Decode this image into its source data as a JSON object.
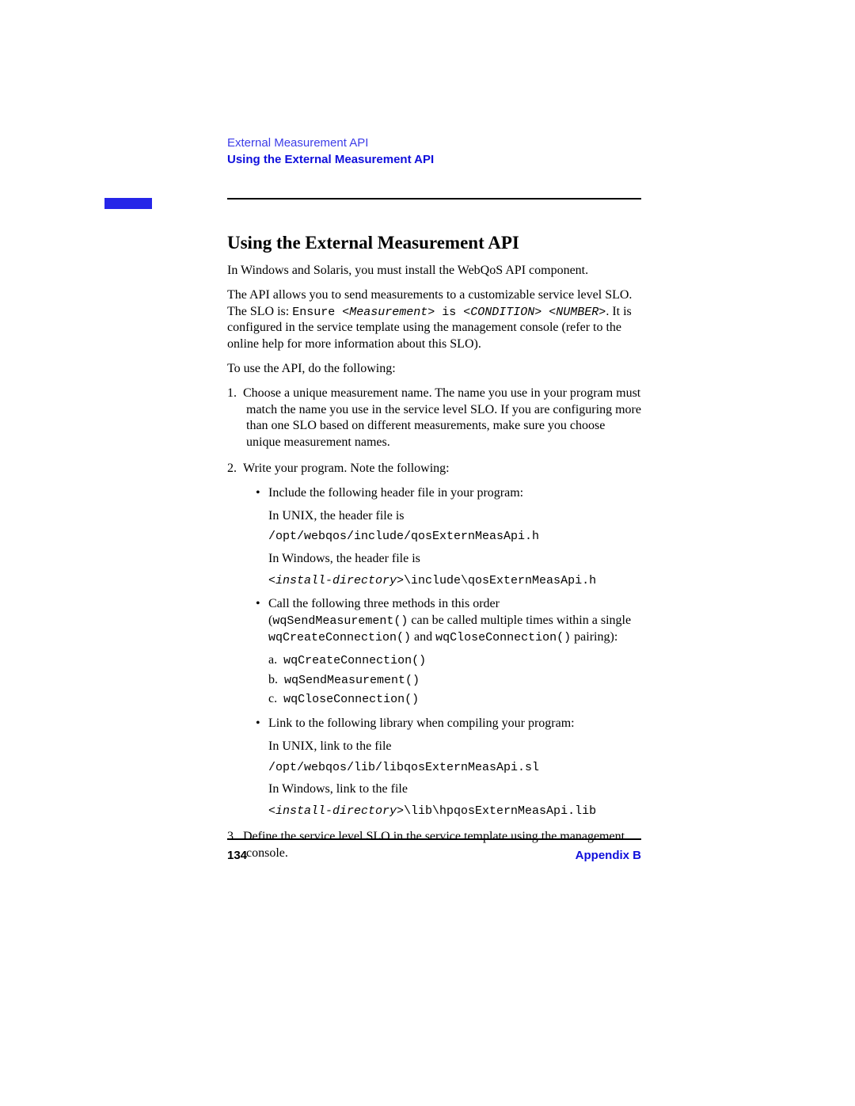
{
  "header": {
    "breadcrumb_light": "External Measurement API",
    "breadcrumb_bold": "Using the External Measurement API"
  },
  "heading": "Using the External Measurement API",
  "para1": "In Windows and Solaris, you must install the WebQoS API component.",
  "para2_pre": "The API allows you to send measurements to a customizable service level SLO. The SLO is: ",
  "para2_code1": "Ensure ",
  "para2_code2": "<Measurement>",
  "para2_code3": " is ",
  "para2_code4": "<CONDITION> <NUMBER>",
  "para2_post": ". It is configured in the service template using the management console (refer to the online help for more information about this SLO).",
  "para3": "To use the API, do the following:",
  "li1": "Choose a unique measurement name. The name you use in your program must match the name you use in the service level SLO. If you are configuring more than one SLO based on different measurements, make sure you choose unique measurement names.",
  "li2": "Write your program. Note the following:",
  "b1": "Include the following header file in your program:",
  "b1_unix_label": "In UNIX, the header file is",
  "b1_unix_path": "/opt/webqos/include/qosExternMeasApi.h",
  "b1_win_label": "In Windows, the header file is",
  "b1_win_path1": "<install-directory>",
  "b1_win_path2": "\\include\\qosExternMeasApi.h",
  "b2_pre": "Call the following three methods in this order (",
  "b2_code1": "wqSendMeasurement()",
  "b2_mid1": " can be called multiple times within a single ",
  "b2_code2": "wqCreateConnection()",
  "b2_mid2": " and ",
  "b2_code3": "wqCloseConnection()",
  "b2_post": " pairing):",
  "b2_a": "wqCreateConnection()",
  "b2_b": "wqSendMeasurement()",
  "b2_c": "wqCloseConnection()",
  "b3": "Link to the following library when compiling your program:",
  "b3_unix_label": "In UNIX, link to the file",
  "b3_unix_path": "/opt/webqos/lib/libqosExternMeasApi.sl",
  "b3_win_label": "In Windows, link to the file",
  "b3_win_path1": "<install-directory>",
  "b3_win_path2": "\\lib\\hpqosExternMeasApi.lib",
  "li3": "Define the service level SLO in the service template using the management console.",
  "footer": {
    "page_number": "134",
    "appendix": "Appendix B"
  }
}
